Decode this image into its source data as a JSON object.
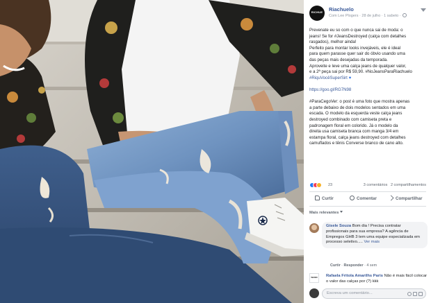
{
  "post": {
    "page_name": "Riachuelo",
    "avatar_text": "RICHUE",
    "meta": "Com Lee Plogers · 28 de julho · 1 sabeto · ",
    "caption_lines": [
      "Prevenate eu so com o que nunca sai de moda: o",
      "jeans! Se for #JeansDestroyed (calça com detalhes",
      "rasgados), melhor ainda!",
      "Perfeito para montar looks invejáveis, ele é ideal",
      "para quem parasse quer sair do óbvio usando uma",
      "das peças mais desejadas da temporada.",
      "Aproveite e leve uma calça jeans de qualquer valor,",
      "e a 2ª peça sai por R$ 59,90. #NoJeansParaRiachuelo",
      "#RiquVocêSuperSirt"
    ],
    "link": "https://goo.gl/RG7N98",
    "description_lines": [
      "#ParaCegoVer: o post é uma foto que mostra apenas",
      "a parte debaixo de dois modelos sentados em uma",
      "escada. O modelo da esquerda veste calça jeans",
      "destroyed combinado com camiseta preta e",
      "padronagem floral em colorido. Já o modelo da",
      "direita usa camiseta branca com manga 3/4 em",
      "estampa floral, calça jeans destroyed com detalhes",
      "camuflados e tênis Converse branco de cano alto."
    ]
  },
  "reactions": {
    "count": "23",
    "comments_count": "3 comentários",
    "shares_count": "2 compartilhamentos"
  },
  "actions": {
    "like": "Curtir",
    "comment": "Comentar",
    "share": "Compartilhar"
  },
  "comments": {
    "filter": "Mais relevantes",
    "first": {
      "author": "Gisele Souza",
      "text": "Bom dia ! Precisa contratar profissionais para sua empresa? A agência de Empregos GHB 3 tem uma equipe especializada em processo seletivo..... ",
      "see_more": "Ver mais",
      "like": "Curtir",
      "reply": "Responder",
      "time": "· 4 sem"
    },
    "second": {
      "author": "Rafaela Fritola Amarilhs Paris",
      "text": "Não é mais fácil colocar o valor das calças por (?) kkk",
      "avatar_text": "WANN"
    },
    "write_placeholder": "Escreva um comentário..."
  },
  "colors": {
    "link": "#385898",
    "text": "#1c1e21",
    "muted": "#606770"
  }
}
